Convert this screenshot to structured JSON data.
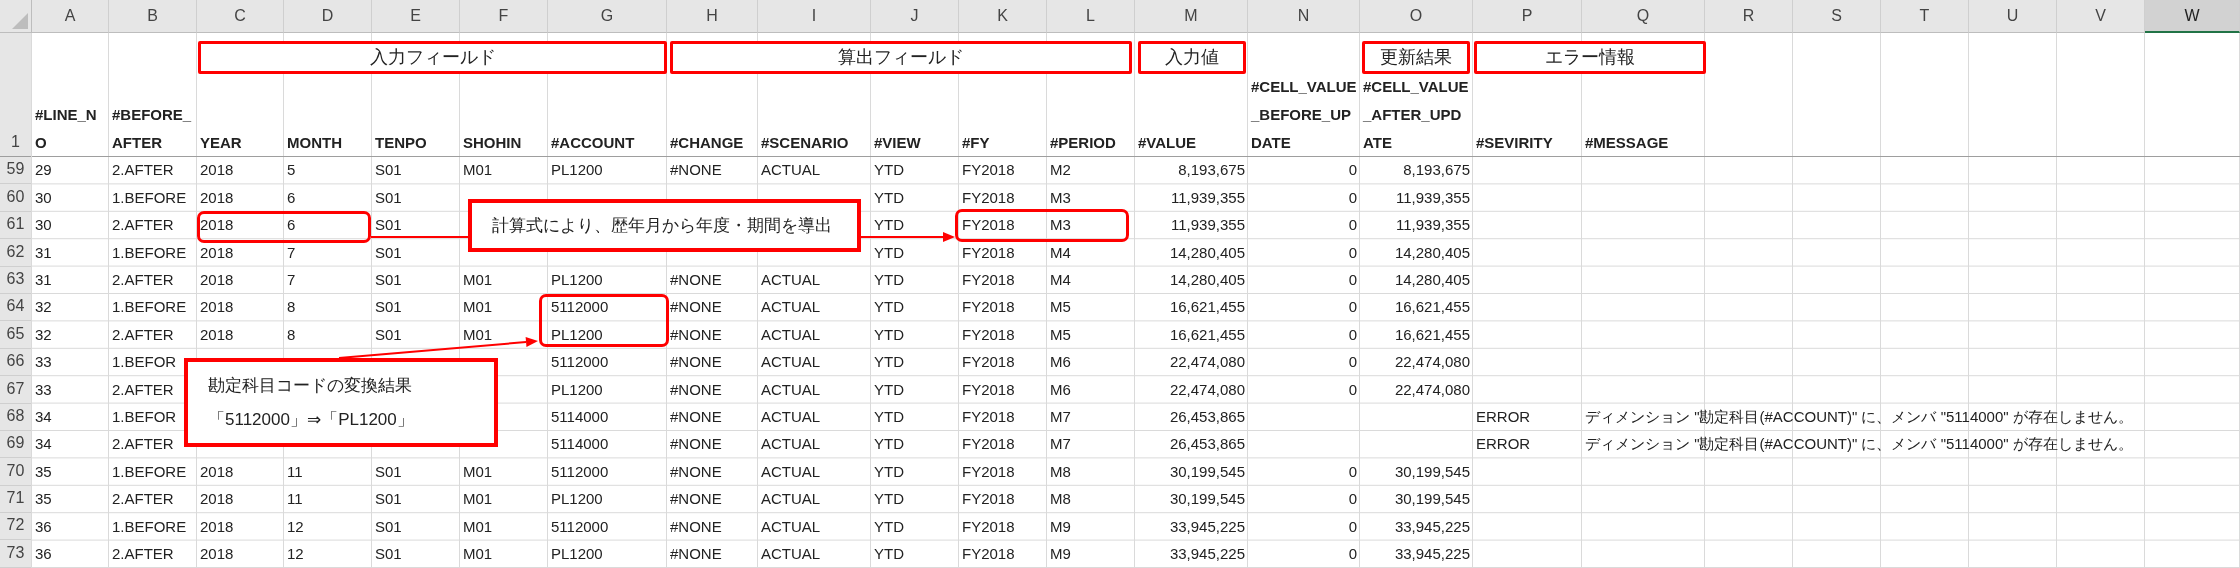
{
  "columns": [
    {
      "label": "A",
      "selected": false
    },
    {
      "label": "B",
      "selected": false
    },
    {
      "label": "C",
      "selected": false
    },
    {
      "label": "D",
      "selected": false
    },
    {
      "label": "E",
      "selected": false
    },
    {
      "label": "F",
      "selected": false
    },
    {
      "label": "G",
      "selected": false
    },
    {
      "label": "H",
      "selected": false
    },
    {
      "label": "I",
      "selected": false
    },
    {
      "label": "J",
      "selected": false
    },
    {
      "label": "K",
      "selected": false
    },
    {
      "label": "L",
      "selected": false
    },
    {
      "label": "M",
      "selected": false
    },
    {
      "label": "N",
      "selected": false
    },
    {
      "label": "O",
      "selected": false
    },
    {
      "label": "P",
      "selected": false
    },
    {
      "label": "Q",
      "selected": false
    },
    {
      "label": "R",
      "selected": false
    },
    {
      "label": "S",
      "selected": false
    },
    {
      "label": "T",
      "selected": false
    },
    {
      "label": "U",
      "selected": false
    },
    {
      "label": "V",
      "selected": false
    },
    {
      "label": "W",
      "selected": true
    }
  ],
  "field_groups": [
    {
      "label": "入力フィールド"
    },
    {
      "label": "算出フィールド"
    },
    {
      "label": "入力値"
    },
    {
      "label": "更新結果"
    },
    {
      "label": "エラー情報"
    }
  ],
  "header_row": {
    "row": "1",
    "cells": {
      "A": "#LINE_NO",
      "B": "#BEFORE_AFTER",
      "C": "YEAR",
      "D": "MONTH",
      "E": "TENPO",
      "F": "SHOHIN",
      "G": "#ACCOUNT",
      "H": "#CHANGE",
      "I": "#SCENARIO",
      "J": "#VIEW",
      "K": "#FY",
      "L": "#PERIOD",
      "M": "#VALUE",
      "N": "#CELL_VALUE_BEFORE_UPDATE",
      "O": "#CELL_VALUE_AFTER_UPDATE",
      "P": "#SEVIRITY",
      "Q": "#MESSAGE"
    }
  },
  "rows": [
    {
      "row": "59",
      "cells": {
        "A": "29",
        "B": "2.AFTER",
        "C": "2018",
        "D": "5",
        "E": "S01",
        "F": "M01",
        "G": "PL1200",
        "H": "#NONE",
        "I": "ACTUAL",
        "J": "YTD",
        "K": "FY2018",
        "L": "M2",
        "M": "8,193,675",
        "N": "0",
        "O": "8,193,675"
      }
    },
    {
      "row": "60",
      "cells": {
        "A": "30",
        "B": "1.BEFORE",
        "C": "2018",
        "D": "6",
        "E": "S01",
        "J": "YTD",
        "K": "FY2018",
        "L": "M3",
        "M": "11,939,355",
        "N": "0",
        "O": "11,939,355"
      }
    },
    {
      "row": "61",
      "cells": {
        "A": "30",
        "B": "2.AFTER",
        "C": "2018",
        "D": "6",
        "E": "S01",
        "J": "YTD",
        "K": "FY2018",
        "L": "M3",
        "M": "11,939,355",
        "N": "0",
        "O": "11,939,355"
      }
    },
    {
      "row": "62",
      "cells": {
        "A": "31",
        "B": "1.BEFORE",
        "C": "2018",
        "D": "7",
        "E": "S01",
        "J": "YTD",
        "K": "FY2018",
        "L": "M4",
        "M": "14,280,405",
        "N": "0",
        "O": "14,280,405"
      }
    },
    {
      "row": "63",
      "cells": {
        "A": "31",
        "B": "2.AFTER",
        "C": "2018",
        "D": "7",
        "E": "S01",
        "F": "M01",
        "G": "PL1200",
        "H": "#NONE",
        "I": "ACTUAL",
        "J": "YTD",
        "K": "FY2018",
        "L": "M4",
        "M": "14,280,405",
        "N": "0",
        "O": "14,280,405"
      }
    },
    {
      "row": "64",
      "cells": {
        "A": "32",
        "B": "1.BEFORE",
        "C": "2018",
        "D": "8",
        "E": "S01",
        "F": "M01",
        "G": "5112000",
        "H": "#NONE",
        "I": "ACTUAL",
        "J": "YTD",
        "K": "FY2018",
        "L": "M5",
        "M": "16,621,455",
        "N": "0",
        "O": "16,621,455"
      }
    },
    {
      "row": "65",
      "cells": {
        "A": "32",
        "B": "2.AFTER",
        "C": "2018",
        "D": "8",
        "E": "S01",
        "F": "M01",
        "G": "PL1200",
        "H": "#NONE",
        "I": "ACTUAL",
        "J": "YTD",
        "K": "FY2018",
        "L": "M5",
        "M": "16,621,455",
        "N": "0",
        "O": "16,621,455"
      }
    },
    {
      "row": "66",
      "cells": {
        "A": "33",
        "B": "1.BEFOR",
        "G": "5112000",
        "H": "#NONE",
        "I": "ACTUAL",
        "J": "YTD",
        "K": "FY2018",
        "L": "M6",
        "M": "22,474,080",
        "N": "0",
        "O": "22,474,080"
      }
    },
    {
      "row": "67",
      "cells": {
        "A": "33",
        "B": "2.AFTER",
        "G": "PL1200",
        "H": "#NONE",
        "I": "ACTUAL",
        "J": "YTD",
        "K": "FY2018",
        "L": "M6",
        "M": "22,474,080",
        "N": "0",
        "O": "22,474,080"
      }
    },
    {
      "row": "68",
      "cells": {
        "A": "34",
        "B": "1.BEFOR",
        "G": "5114000",
        "H": "#NONE",
        "I": "ACTUAL",
        "J": "YTD",
        "K": "FY2018",
        "L": "M7",
        "M": "26,453,865",
        "P": "ERROR",
        "Q": "ディメンション \"勘定科目(#ACCOUNT)\" に、メンバ \"5114000\" が存在しません。"
      }
    },
    {
      "row": "69",
      "cells": {
        "A": "34",
        "B": "2.AFTER",
        "G": "5114000",
        "H": "#NONE",
        "I": "ACTUAL",
        "J": "YTD",
        "K": "FY2018",
        "L": "M7",
        "M": "26,453,865",
        "P": "ERROR",
        "Q": "ディメンション \"勘定科目(#ACCOUNT)\" に、メンバ \"5114000\" が存在しません。"
      }
    },
    {
      "row": "70",
      "cells": {
        "A": "35",
        "B": "1.BEFORE",
        "C": "2018",
        "D": "11",
        "E": "S01",
        "F": "M01",
        "G": "5112000",
        "H": "#NONE",
        "I": "ACTUAL",
        "J": "YTD",
        "K": "FY2018",
        "L": "M8",
        "M": "30,199,545",
        "N": "0",
        "O": "30,199,545"
      }
    },
    {
      "row": "71",
      "cells": {
        "A": "35",
        "B": "2.AFTER",
        "C": "2018",
        "D": "11",
        "E": "S01",
        "F": "M01",
        "G": "PL1200",
        "H": "#NONE",
        "I": "ACTUAL",
        "J": "YTD",
        "K": "FY2018",
        "L": "M8",
        "M": "30,199,545",
        "N": "0",
        "O": "30,199,545"
      }
    },
    {
      "row": "72",
      "cells": {
        "A": "36",
        "B": "1.BEFORE",
        "C": "2018",
        "D": "12",
        "E": "S01",
        "F": "M01",
        "G": "5112000",
        "H": "#NONE",
        "I": "ACTUAL",
        "J": "YTD",
        "K": "FY2018",
        "L": "M9",
        "M": "33,945,225",
        "N": "0",
        "O": "33,945,225"
      }
    },
    {
      "row": "73",
      "cells": {
        "A": "36",
        "B": "2.AFTER",
        "C": "2018",
        "D": "12",
        "E": "S01",
        "F": "M01",
        "G": "PL1200",
        "H": "#NONE",
        "I": "ACTUAL",
        "J": "YTD",
        "K": "FY2018",
        "L": "M9",
        "M": "33,945,225",
        "N": "0",
        "O": "33,945,225"
      }
    }
  ],
  "callouts": [
    {
      "lines": [
        "計算式により、歴年月から年度・期間を導出"
      ]
    },
    {
      "lines": [
        "勘定科目コードの変換結果",
        "「5112000」⇒「PL1200」"
      ]
    }
  ]
}
